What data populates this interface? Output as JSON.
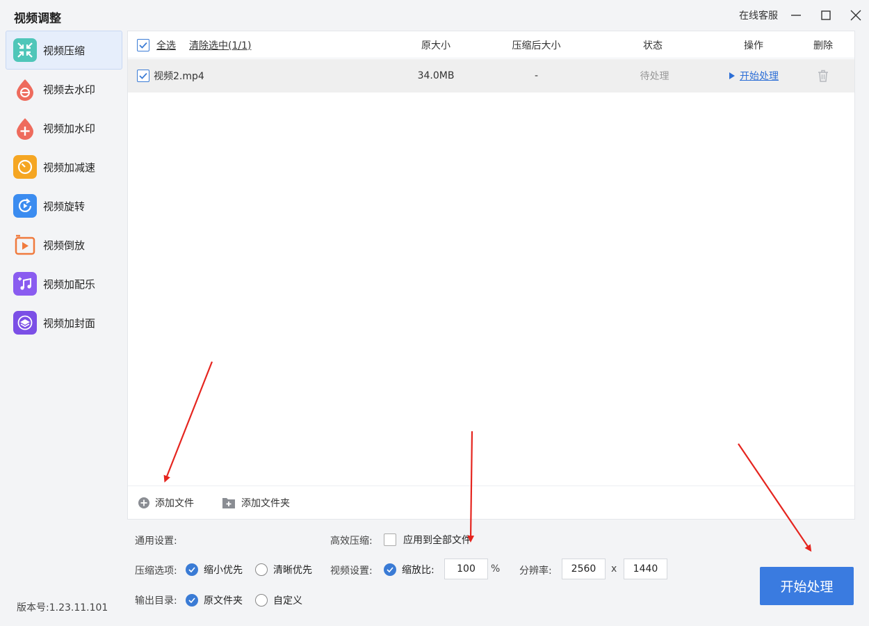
{
  "app": {
    "title": "视频调整",
    "support": "在线客服",
    "version": "版本号:1.23.11.101"
  },
  "sidebar": {
    "items": [
      {
        "label": "视频压缩",
        "icon": "compress-icon",
        "color": "#4fc6b9",
        "active": true
      },
      {
        "label": "视频去水印",
        "icon": "remove-watermark-icon",
        "color": "#ee6b5d"
      },
      {
        "label": "视频加水印",
        "icon": "add-watermark-icon",
        "color": "#ee6b5d"
      },
      {
        "label": "视频加减速",
        "icon": "speed-icon",
        "color": "#f5a623"
      },
      {
        "label": "视频旋转",
        "icon": "rotate-icon",
        "color": "#3b8cf0"
      },
      {
        "label": "视频倒放",
        "icon": "reverse-icon",
        "color": "#f07a3d"
      },
      {
        "label": "视频加配乐",
        "icon": "music-icon",
        "color": "#8a5cf0"
      },
      {
        "label": "视频加封面",
        "icon": "cover-icon",
        "color": "#7b4fe6"
      }
    ]
  },
  "table": {
    "select_all": "全选",
    "clear_selected": "清除选中(1/1)",
    "columns": {
      "original_size": "原大小",
      "compressed_size": "压缩后大小",
      "status": "状态",
      "action": "操作",
      "delete": "删除"
    },
    "rows": [
      {
        "name": "视频2.mp4",
        "original_size": "34.0MB",
        "compressed_size": "-",
        "status": "待处理",
        "action": "开始处理"
      }
    ],
    "add_file": "添加文件",
    "add_folder": "添加文件夹"
  },
  "settings": {
    "general_label": "通用设置:",
    "efficient_label": "高效压缩:",
    "apply_all": "应用到全部文件",
    "compress_label": "压缩选项:",
    "opt_small": "缩小优先",
    "opt_clear": "清晰优先",
    "video_label": "视频设置:",
    "scale_label": "缩放比:",
    "scale_value": "100",
    "percent": "%",
    "resolution_label": "分辨率:",
    "res_w": "2560",
    "times": "x",
    "res_h": "1440",
    "output_label": "输出目录:",
    "out_original": "原文件夹",
    "out_custom": "自定义"
  },
  "start_button": "开始处理",
  "colors": {
    "accent": "#3a7be0",
    "annotation_arrow": "#e5251f"
  }
}
